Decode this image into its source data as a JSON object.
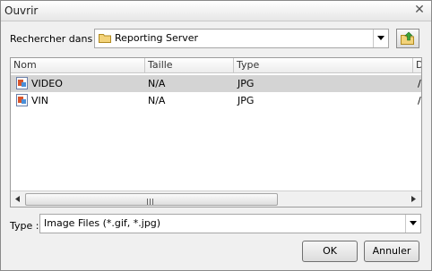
{
  "dialog": {
    "title": "Ouvrir"
  },
  "lookin": {
    "label": "Rechercher dans :",
    "value": "Reporting Server"
  },
  "filelist": {
    "columns": [
      "Nom",
      "Taille",
      "Type",
      "D"
    ],
    "rows": [
      {
        "name": "VIDEO",
        "size": "N/A",
        "type": "JPG",
        "date": "/",
        "selected": true
      },
      {
        "name": "VIN",
        "size": "N/A",
        "type": "JPG",
        "date": "/",
        "selected": false
      }
    ],
    "scrollbar_grip": "III"
  },
  "filetype": {
    "label": "Type :",
    "value": "Image Files (*.gif, *.jpg)"
  },
  "buttons": {
    "ok": "OK",
    "cancel": "Annuler"
  },
  "icons": {
    "close": "close-icon",
    "folder": "folder-icon",
    "up": "up-folder-icon",
    "dropdown": "chevron-down-icon",
    "image_file": "image-file-icon"
  },
  "colors": {
    "selected_row": "#d4d4d4",
    "dialog_bg": "#f0f0f0",
    "folder": "#e8c35a"
  }
}
